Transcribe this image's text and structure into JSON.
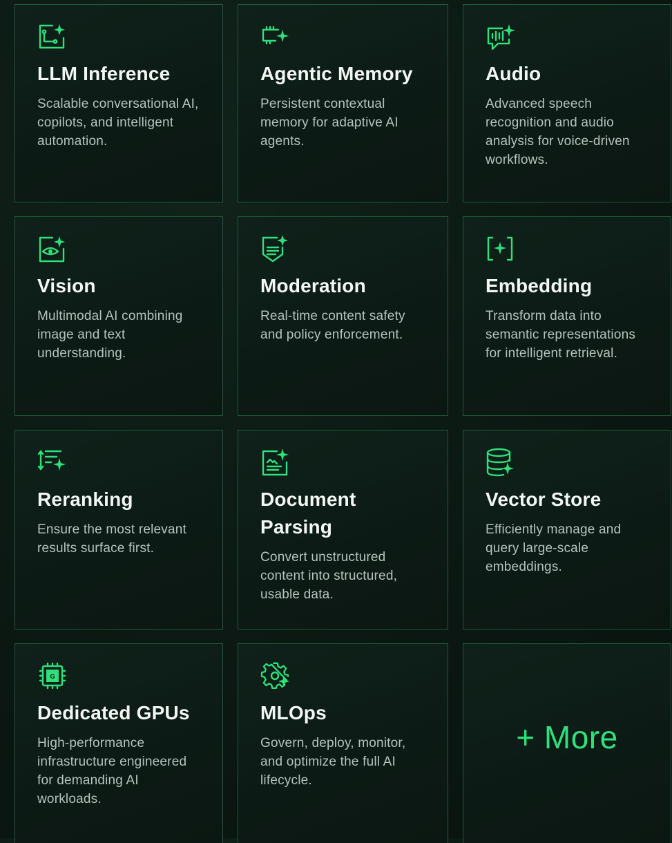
{
  "cards": [
    {
      "icon": "workflow-sparkle-icon",
      "title": "LLM Inference",
      "desc": "Scalable conversational AI, copilots, and intelligent automation."
    },
    {
      "icon": "memory-chip-sparkle-icon",
      "title": "Agentic Memory",
      "desc": "Persistent contextual memory for adaptive AI agents."
    },
    {
      "icon": "audio-waveform-sparkle-icon",
      "title": "Audio",
      "desc": "Advanced speech recognition and audio analysis for voice-driven workflows."
    },
    {
      "icon": "eye-sparkle-icon",
      "title": "Vision",
      "desc": "Multimodal AI combining image and text understanding."
    },
    {
      "icon": "shield-sparkle-icon",
      "title": "Moderation",
      "desc": "Real-time content safety and policy enforcement."
    },
    {
      "icon": "bracket-sparkle-icon",
      "title": "Embedding",
      "desc": "Transform data into semantic representations for intelligent retrieval."
    },
    {
      "icon": "sort-sparkle-icon",
      "title": "Reranking",
      "desc": "Ensure the most relevant results surface first."
    },
    {
      "icon": "document-sparkle-icon",
      "title": "Document Parsing",
      "desc": "Convert unstructured content into structured, usable data."
    },
    {
      "icon": "database-sparkle-icon",
      "title": "Vector Store",
      "desc": "Efficiently manage and query large-scale embeddings."
    },
    {
      "icon": "gpu-chip-icon",
      "title": "Dedicated GPUs",
      "desc": "High-performance infrastructure engineered for demanding AI workloads."
    },
    {
      "icon": "gear-sparkle-icon",
      "title": "MLOps",
      "desc": "Govern, deploy, monitor, and optimize the full AI lifecycle."
    }
  ],
  "more": {
    "label": "+ More"
  },
  "colors": {
    "accent": "#2fe07a",
    "border": "#1f5a3b",
    "background": "#0b1712"
  }
}
